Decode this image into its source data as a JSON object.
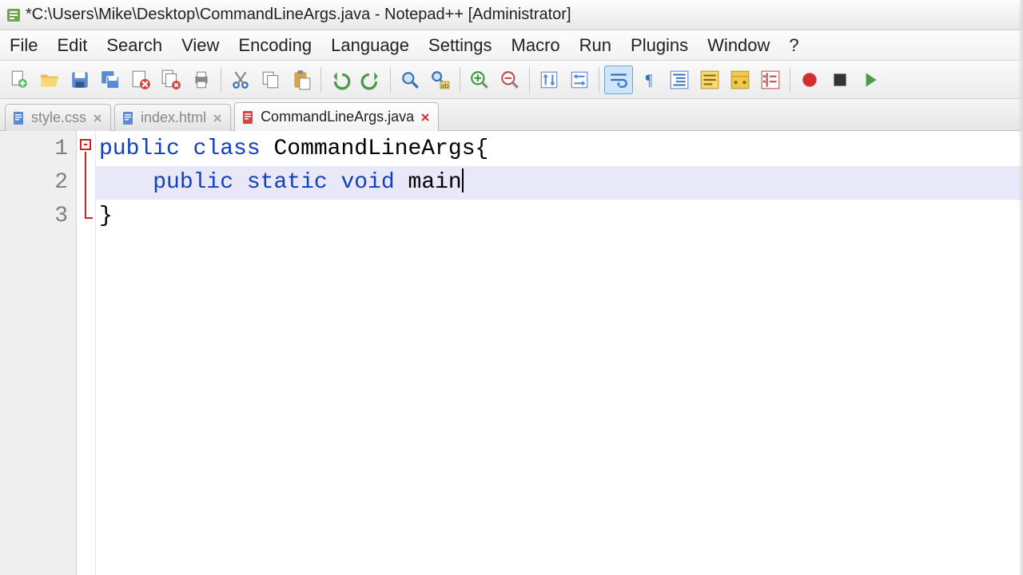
{
  "titlebar": {
    "text": "*C:\\Users\\Mike\\Desktop\\CommandLineArgs.java - Notepad++ [Administrator]"
  },
  "menu": {
    "file": "File",
    "edit": "Edit",
    "search": "Search",
    "view": "View",
    "encoding": "Encoding",
    "language": "Language",
    "settings": "Settings",
    "macro": "Macro",
    "run": "Run",
    "plugins": "Plugins",
    "window": "Window",
    "help": "?"
  },
  "toolbar_icons": [
    "new",
    "open",
    "save",
    "save-all",
    "close",
    "close-all",
    "print",
    "|",
    "cut",
    "copy",
    "paste",
    "|",
    "undo",
    "redo",
    "|",
    "find",
    "replace",
    "|",
    "zoom-in",
    "zoom-out",
    "|",
    "sync-v",
    "sync-h",
    "|",
    "word-wrap",
    "show-all",
    "indent-guide",
    "ud-lang",
    "folder",
    "function-list",
    "|",
    "record",
    "stop",
    "play"
  ],
  "tabs": [
    {
      "label": "style.css",
      "active": false,
      "modified": false,
      "icon": "css"
    },
    {
      "label": "index.html",
      "active": false,
      "modified": false,
      "icon": "html"
    },
    {
      "label": "CommandLineArgs.java",
      "active": true,
      "modified": true,
      "icon": "java"
    }
  ],
  "code": {
    "line_numbers": [
      "1",
      "2",
      "3"
    ],
    "lines": [
      {
        "tokens": [
          {
            "t": "public",
            "c": "kw"
          },
          {
            "t": " ",
            "c": "txt"
          },
          {
            "t": "class",
            "c": "kw"
          },
          {
            "t": " CommandLineArgs{",
            "c": "txt"
          }
        ],
        "current": false
      },
      {
        "tokens": [
          {
            "t": "    ",
            "c": "txt"
          },
          {
            "t": "public",
            "c": "kw"
          },
          {
            "t": " ",
            "c": "txt"
          },
          {
            "t": "static",
            "c": "kw"
          },
          {
            "t": " ",
            "c": "txt"
          },
          {
            "t": "void",
            "c": "kw"
          },
          {
            "t": " main",
            "c": "txt"
          }
        ],
        "current": true
      },
      {
        "tokens": [
          {
            "t": "}",
            "c": "txt"
          }
        ],
        "current": false
      }
    ],
    "fold_marker": "-"
  }
}
